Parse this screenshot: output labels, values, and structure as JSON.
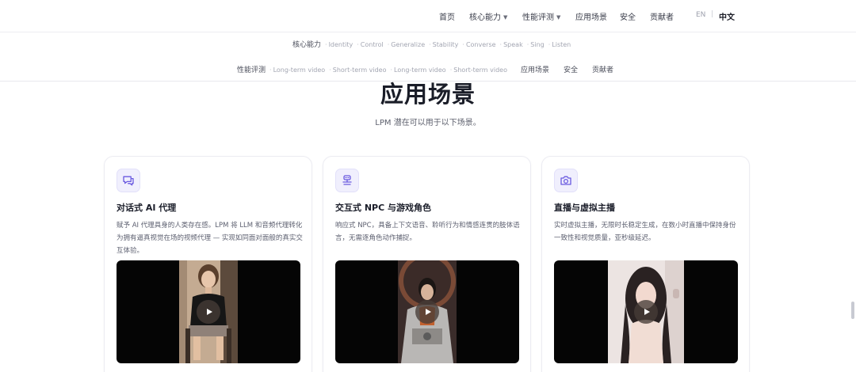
{
  "nav": {
    "items": [
      {
        "label": "首页",
        "dropdown": false
      },
      {
        "label": "核心能力",
        "dropdown": true
      },
      {
        "label": "性能评测",
        "dropdown": true
      },
      {
        "label": "应用场景",
        "dropdown": false
      },
      {
        "label": "安全",
        "dropdown": false
      },
      {
        "label": "贡献者",
        "dropdown": false
      }
    ],
    "lang_en": "EN",
    "lang_sep": "|",
    "lang_zh": "中文"
  },
  "subnav": {
    "row1": {
      "head": "核心能力",
      "items": [
        "Identity",
        "Control",
        "Generalize",
        "Stability",
        "Converse",
        "Speak",
        "Sing",
        "Listen"
      ]
    },
    "row2": {
      "head": "性能评测",
      "items": [
        "Long-term video",
        "Short-term video",
        "Long-term video",
        "Short-term video"
      ],
      "links": [
        "应用场景",
        "安全",
        "贡献者"
      ]
    }
  },
  "section": {
    "title": "应用场景",
    "subtitle": "LPM 潜在可以用于以下场景。"
  },
  "cards": [
    {
      "icon": "chat-bubble-icon",
      "title": "对话式 AI 代理",
      "desc": "赋予 AI 代理具身的人类存在感。LPM 将 LLM 和音频代理转化为拥有逼真视觉在场的视频代理 — 实现如同面对面般的真实交互体验。"
    },
    {
      "icon": "game-character-icon",
      "title": "交互式 NPC 与游戏角色",
      "desc": "响应式 NPC，具备上下文语音、聆听行为和情感连贯的肢体语言，无需逐角色动作捕捉。"
    },
    {
      "icon": "camera-icon",
      "title": "直播与虚拟主播",
      "desc": "实时虚拟主播，无限时长稳定生成，在数小时直播中保持身份一致性和视觉质量，亚秒级延迟。"
    }
  ],
  "colors": {
    "accent": "#6a5ae0",
    "icon_bg": "#f0effd",
    "text_primary": "#1a1d28",
    "text_secondary": "#5d6070"
  }
}
